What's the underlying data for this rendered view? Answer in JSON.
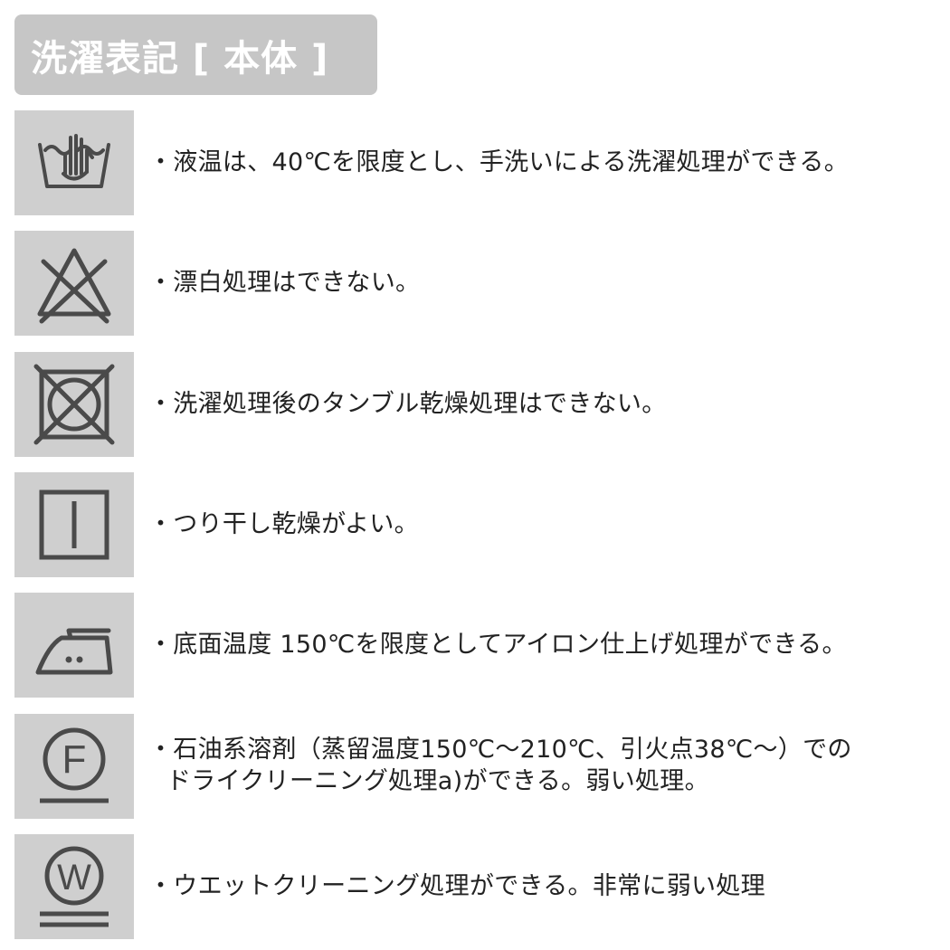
{
  "title": "洗濯表記 [ 本体 ]",
  "colors": {
    "title_background": "#c6c6c6",
    "title_text": "#ffffff",
    "icon_background": "#cfcfcf",
    "icon_stroke": "#4a4a4a",
    "text": "#222222"
  },
  "items": [
    {
      "icon": "hand-wash-40-icon",
      "lines": [
        "・液温は、40℃を限度とし、手洗いによる洗濯処理ができる。"
      ]
    },
    {
      "icon": "no-bleach-icon",
      "lines": [
        "・漂白処理はできない。"
      ]
    },
    {
      "icon": "no-tumble-dry-icon",
      "lines": [
        "・洗濯処理後のタンブル乾燥処理はできない。"
      ]
    },
    {
      "icon": "line-dry-icon",
      "lines": [
        "・つり干し乾燥がよい。"
      ]
    },
    {
      "icon": "iron-low-temp-icon",
      "lines": [
        "・底面温度 150℃を限度としてアイロン仕上げ処理ができる。"
      ]
    },
    {
      "icon": "dry-clean-f-mild-icon",
      "icon_letter": "F",
      "lines": [
        "・石油系溶剤（蒸留温度150℃～210℃、引火点38℃～）での",
        "ドライクリーニング処理a)ができる。弱い処理。"
      ]
    },
    {
      "icon": "wet-clean-w-very-mild-icon",
      "icon_letter": "W",
      "lines": [
        "・ウエットクリーニング処理ができる。非常に弱い処理"
      ]
    }
  ]
}
